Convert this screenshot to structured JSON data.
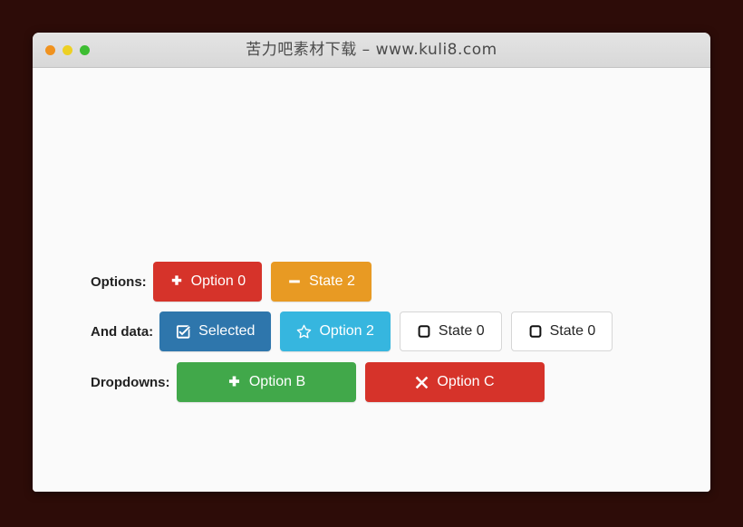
{
  "window": {
    "title": "苦力吧素材下载 – www.kuli8.com",
    "traffic_lights": [
      {
        "name": "close",
        "color": "#f0921f"
      },
      {
        "name": "minimize",
        "color": "#edd024"
      },
      {
        "name": "maximize",
        "color": "#3dbd32"
      }
    ]
  },
  "theme": {
    "page_background": "#2d0c08",
    "window_background": "#fafafa",
    "titlebar_background": "#dcdcdc",
    "red": "#d6332a",
    "orange": "#e89a23",
    "blue": "#2e76ac",
    "cyan": "#36b6df",
    "green": "#41a84a",
    "white_button_border": "#d6d6d6",
    "label_color": "#222222"
  },
  "rows": [
    {
      "label": "Options:",
      "buttons": [
        {
          "text": "Option 0",
          "icon": "plus-icon",
          "style": "red"
        },
        {
          "text": "State 2",
          "icon": "minus-icon",
          "style": "orange"
        }
      ]
    },
    {
      "label": "And data:",
      "buttons": [
        {
          "text": "Selected",
          "icon": "check-square-icon",
          "style": "blue"
        },
        {
          "text": "Option 2",
          "icon": "star-outline-icon",
          "style": "cyan"
        },
        {
          "text": "State 0",
          "icon": "stop-square-icon",
          "style": "white"
        },
        {
          "text": "State 0",
          "icon": "stop-square-icon",
          "style": "white"
        }
      ]
    },
    {
      "label": "Dropdowns:",
      "buttons": [
        {
          "text": "Option B",
          "icon": "plus-icon",
          "style": "green"
        },
        {
          "text": "Option C",
          "icon": "times-icon",
          "style": "crimson"
        }
      ]
    }
  ]
}
